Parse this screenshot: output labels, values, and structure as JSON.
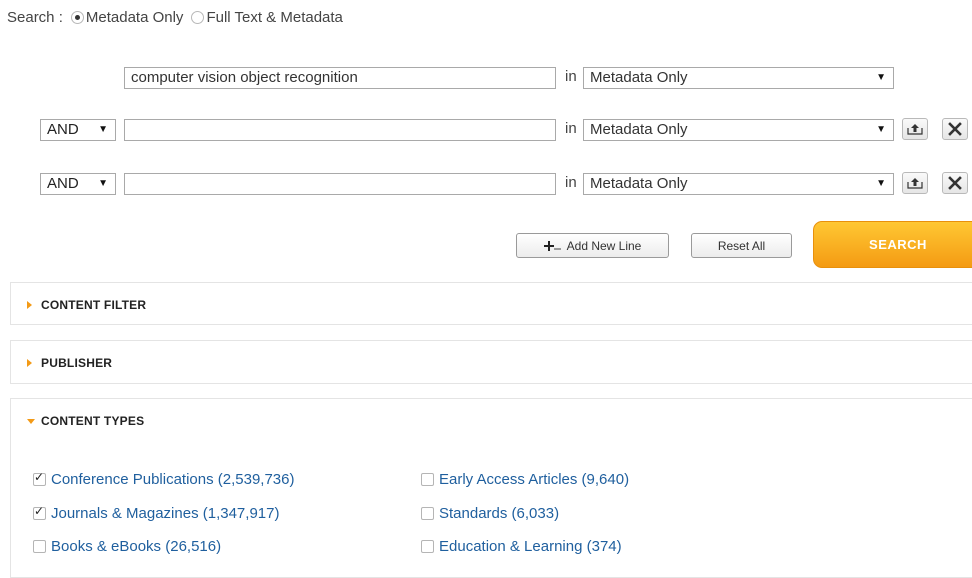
{
  "search_mode": {
    "label": "Search :",
    "options": [
      {
        "label": "Metadata Only",
        "selected": true
      },
      {
        "label": "Full Text & Metadata",
        "selected": false
      }
    ]
  },
  "query_rows": [
    {
      "operator": null,
      "term": "computer vision object recognition",
      "in_label": "in",
      "field": "Metadata Only",
      "removable": false
    },
    {
      "operator": "AND",
      "term": "",
      "in_label": "in",
      "field": "Metadata Only",
      "removable": true
    },
    {
      "operator": "AND",
      "term": "",
      "in_label": "in",
      "field": "Metadata Only",
      "removable": true
    }
  ],
  "buttons": {
    "add_new_line": "Add New Line",
    "reset_all": "Reset All",
    "search": "SEARCH"
  },
  "panels": {
    "content_filter": {
      "title": "CONTENT FILTER",
      "expanded": false
    },
    "publisher": {
      "title": "PUBLISHER",
      "expanded": false
    },
    "content_types": {
      "title": "CONTENT TYPES",
      "expanded": true,
      "items": [
        {
          "label": "Conference Publications (2,539,736)",
          "checked": true
        },
        {
          "label": "Early Access Articles (9,640)",
          "checked": false
        },
        {
          "label": "Journals & Magazines (1,347,917)",
          "checked": true
        },
        {
          "label": "Standards (6,033)",
          "checked": false
        },
        {
          "label": "Books & eBooks (26,516)",
          "checked": false
        },
        {
          "label": "Education & Learning (374)",
          "checked": false
        }
      ]
    }
  },
  "colors": {
    "accent_orange": "#f49b13",
    "link_blue": "#1f5f9e"
  },
  "icons": {
    "move_up": "move-up-icon",
    "remove": "close-icon",
    "add_line": "add-line-icon",
    "dropdown": "triangle-down-icon"
  }
}
